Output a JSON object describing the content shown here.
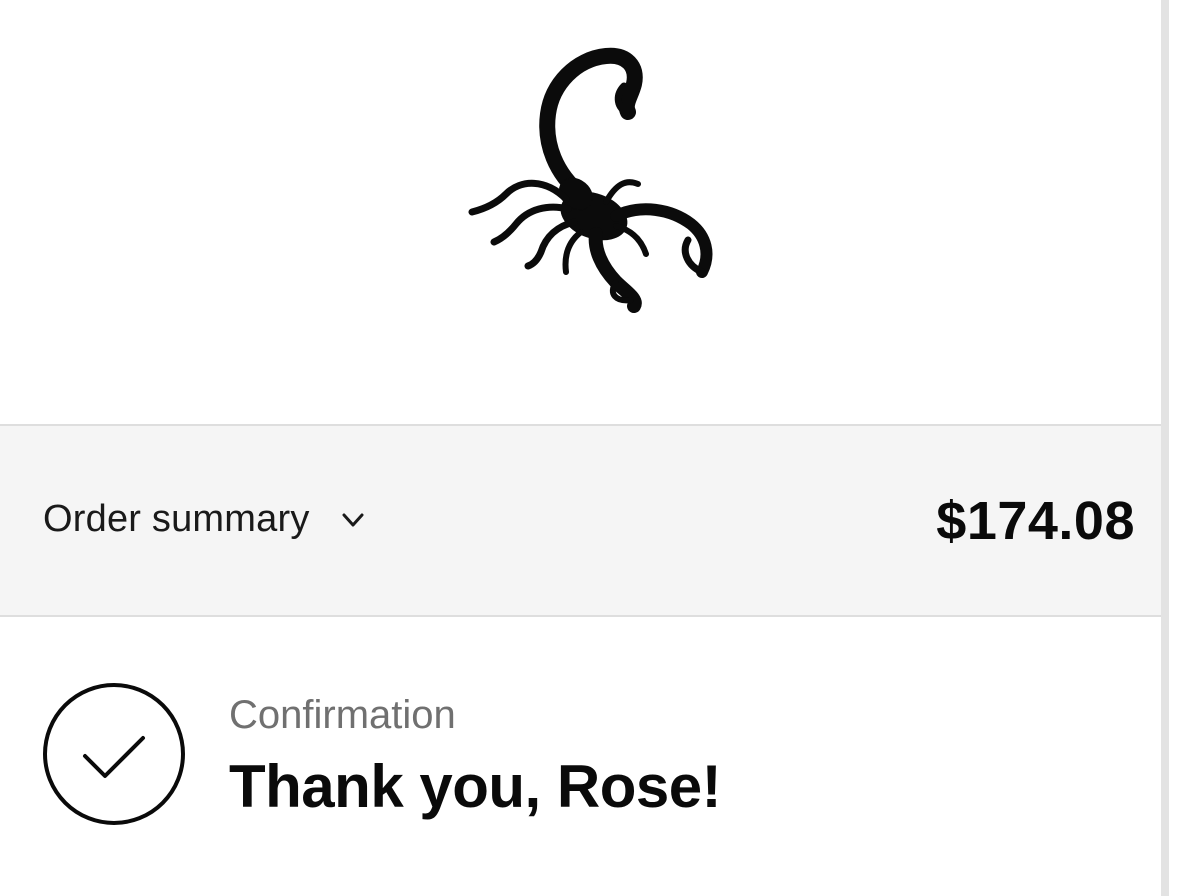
{
  "brand": {
    "logo_icon": "scorpion-icon"
  },
  "order_summary": {
    "label": "Order summary",
    "toggle_icon": "chevron-down-icon",
    "total": "$174.08"
  },
  "confirmation": {
    "label": "Confirmation",
    "status_icon": "checkmark-circle-icon",
    "heading": "Thank you, Rose!"
  }
}
